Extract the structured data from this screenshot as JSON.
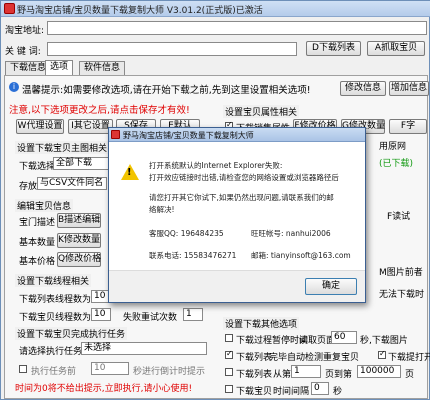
{
  "window": {
    "title": "野马淘宝店铺/宝贝数量下载复制大师 V3.01.2(正式版)已激活"
  },
  "top": {
    "url_label": "淘宝地址:",
    "keyword_label": "关 键 词:",
    "d_btn": "D下载列表",
    "a_btn": "A抓取宝贝"
  },
  "tabs": {
    "download": "下载信息",
    "options": "选项",
    "software": "软件信息"
  },
  "notice": {
    "warm_tip": "温馨提示:如需要修改选项,请在开始下载之前,先到这里设置相关选项!",
    "modify_btn": "修改信息",
    "add_btn": "增加信息",
    "red_warning": "注意,以下选项更改之后,请点击保存才有效!",
    "proxy_btn": "W代理设置",
    "other_btn": "I其它设置",
    "save_btn": "S保存",
    "default_btn": "E默认"
  },
  "left_groups": {
    "main_pic": "设置下载宝贝主图相关",
    "download_to": "下载选择",
    "download_to_value": "全部下载",
    "storage": "存放",
    "storage_value": "与CSV文件同名",
    "edit_info": "编辑宝贝信息",
    "desc": "宝门描述",
    "desc_btn": "B描述编辑",
    "basic": "基本数量",
    "basic_btn": "K修改数量",
    "price": "基本价格",
    "price_btn": "Q修改价格",
    "thread": "设置下载线程相关",
    "list_label": "下载列表",
    "threads_label": "线程数为",
    "threads_value": "10",
    "baobei_label": "下载宝贝",
    "threads2_value": "10",
    "retry_label": "失败重试次数",
    "retry_value": "1",
    "finish": "设置下载宝贝完成执行任务",
    "task_label": "请选择执行任务",
    "task_value": "未选择",
    "task_ready": "执行任务前",
    "task_ready_value": "10",
    "task_ready_tail": "秒进行倒计时提示",
    "red_note": "时间为0将不给出提示,立即执行,请小心使用!"
  },
  "right_groups": {
    "attr": "设置宝贝属性相关",
    "sales_attr": "下载销售属性",
    "price_btn": "F修改价格",
    "qty_btn": "G修改数量",
    "use_source": "用原网",
    "green_note": "(已下载)",
    "field_label": "F字",
    "ask_title": "F读试",
    "pic_label": "M图片前者",
    "no_limit": "无法下载时",
    "other": "设置下载其他选项",
    "interval_label": "下载过程暂停时间",
    "interval_read": "读取页面",
    "interval_value": "60",
    "interval_unit": "秒,下载图片",
    "interval_value2": "1",
    "list_dl": "下载列表",
    "list_dl_tail": "完毕自动检测重复宝贝",
    "dl_intro": "下载提打开",
    "dl_from": "下载列表",
    "from_label": "从第",
    "from_value": "1",
    "page_to": "页到第",
    "page_to_value": "100000",
    "page_unit": "页",
    "dl_baobei": "下载宝贝",
    "interval_time": "时间间隔",
    "interval_time_value": "0",
    "sec": "秒"
  },
  "dialog": {
    "title": "野马淘宝店铺/宝贝数量下载复制大师",
    "line1": "打开系统默认的Internet Explorer失败:",
    "line2": "打开效应链接时出错,请检查您的网络设置或浏览器路径后",
    "line3": "请您打开其它你试下,如果仍然出现问题,请联系我们的邮",
    "line4": "络解决!",
    "qq_label": "客服QQ: 196484235",
    "wangwang_label": "旺旺帐号: nanhui2006",
    "phone_label": "联系电话: 15583476271",
    "email_label": "邮箱: tianyinsoft@163.com",
    "ok_btn": "确定"
  }
}
